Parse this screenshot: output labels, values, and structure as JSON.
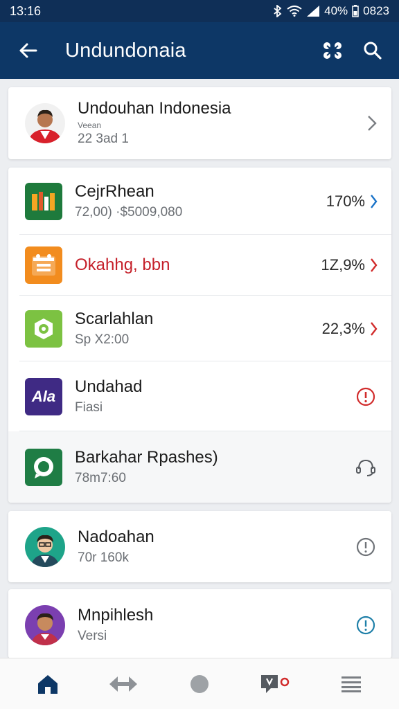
{
  "status": {
    "time": "13:16",
    "battery": "40%",
    "clock2": "0823"
  },
  "header": {
    "title": "Undundonaia",
    "back_icon": "back-arrow-icon",
    "action1_icon": "share-nodes-icon",
    "action2_icon": "search-icon"
  },
  "profile": {
    "name": "Undouhan Indonesia",
    "small": "Veean",
    "sub": "22 3ad 1"
  },
  "apps": [
    {
      "name": "CejrRhean",
      "sub": "72,00) ·$5009,080",
      "value": "170%",
      "icon": "bars-app-icon",
      "color": "#1e7a3c"
    },
    {
      "name": "Okahhg, bbn",
      "sub": "",
      "value": "1Z,9%",
      "icon": "calendar-app-icon",
      "color": "#f28c1e"
    },
    {
      "name": "Scarlahlan",
      "sub": "Sp X2:00",
      "value": "22,3%",
      "icon": "circle-app-icon",
      "color": "#7cc242"
    },
    {
      "name": "Undahad",
      "sub": "Fiasi",
      "value": "",
      "icon": "aa-app-icon",
      "color": "#4a2a8a",
      "icon_label": "Ala"
    },
    {
      "name": "Barkahar Rpashes)",
      "sub": "78m7:60",
      "value": "",
      "icon": "chat-app-icon",
      "color": "#1f7d45"
    }
  ],
  "contacts": [
    {
      "name": "Nadoahan",
      "sub": "70r 160k"
    },
    {
      "name": "Mnpihlesh",
      "sub": "Versi"
    }
  ],
  "nav": [
    "home-icon",
    "swap-arrows-icon",
    "circle-icon",
    "message-badge-icon",
    "menu-icon"
  ]
}
